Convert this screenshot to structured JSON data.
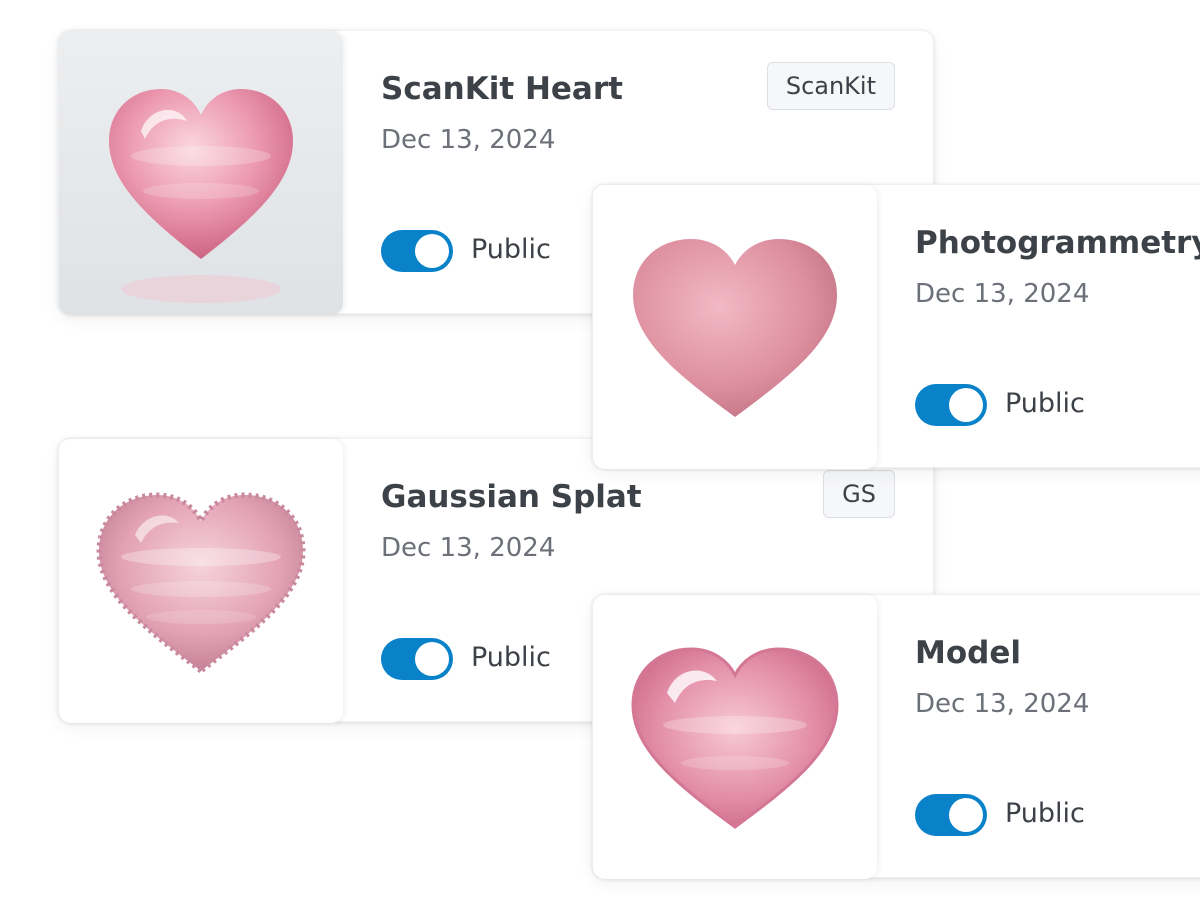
{
  "cards": [
    {
      "title": "ScanKit Heart",
      "date": "Dec 13, 2024",
      "badge": "ScanKit",
      "visibility_label": "Public",
      "public": true,
      "thumbnail_icon": "glossy-pink-heart-on-gray"
    },
    {
      "title": "Photogrammetry",
      "date": "Dec 13, 2024",
      "visibility_label": "Public",
      "public": true,
      "thumbnail_icon": "matte-pink-heart"
    },
    {
      "title": "Gaussian Splat",
      "date": "Dec 13, 2024",
      "badge": "GS",
      "visibility_label": "Public",
      "public": true,
      "thumbnail_icon": "splat-pink-heart"
    },
    {
      "title": "Model",
      "date": "Dec 13, 2024",
      "visibility_label": "Public",
      "public": true,
      "thumbnail_icon": "glass-pink-heart"
    }
  ],
  "colors": {
    "toggle_on": "#0a82c9",
    "title_text": "#3d4148",
    "date_text": "#6c7079",
    "heart_pink": "#e79bb0"
  }
}
